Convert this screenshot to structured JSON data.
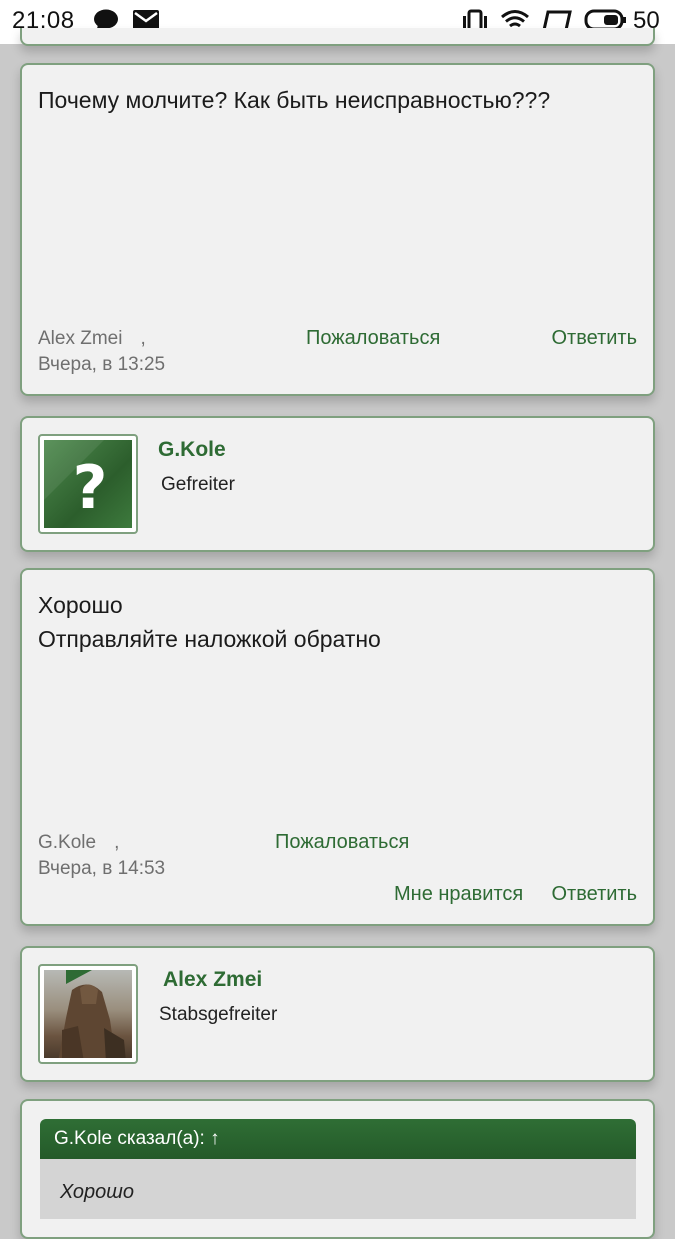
{
  "status_bar": {
    "time": "21:08",
    "battery": "50"
  },
  "posts": [
    {
      "text_lines": [
        "Почему молчите? Как быть неисправностью???"
      ],
      "author": "Alex Zmei",
      "sep": ",",
      "date": "Вчера, в 13:25",
      "report": "Пожаловаться",
      "reply": "Ответить"
    },
    {
      "text_lines": [
        "Хорошо",
        "Отправляйте наложкой обратно"
      ],
      "author": "G.Kole",
      "sep": ",",
      "date": "Вчера, в 14:53",
      "report": "Пожаловаться",
      "like": "Мне нравится",
      "reply": "Ответить"
    }
  ],
  "users": [
    {
      "name": "G.Kole",
      "rank": "Gefreiter",
      "avatar": "question-mark-avatar"
    },
    {
      "name": "Alex Zmei",
      "rank": "Stabsgefreiter",
      "avatar": "photo-avatar"
    }
  ],
  "quote": {
    "header": "G.Kole сказал(а): ↑",
    "text": "Хорошо"
  },
  "colors": {
    "accent": "#2e6b34",
    "card_bg": "#f1f1f1",
    "card_border": "#7fa07f",
    "page_bg": "#c9c9c9"
  }
}
